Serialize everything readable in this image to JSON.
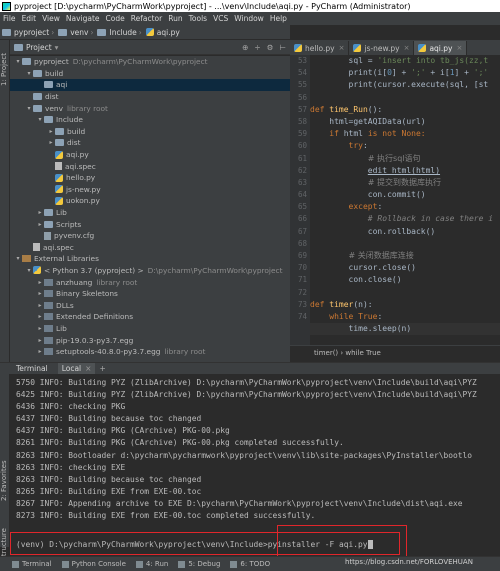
{
  "window": {
    "title": "pyproject [D:\\pycharm\\PyCharmWork\\pyproject] - ...\\venv\\Include\\aqi.py - PyCharm (Administrator)"
  },
  "menu": [
    "File",
    "Edit",
    "View",
    "Navigate",
    "Code",
    "Refactor",
    "Run",
    "Tools",
    "VCS",
    "Window",
    "Help"
  ],
  "breadcrumbs": [
    "pyproject",
    "venv",
    "Include",
    "aqi.py"
  ],
  "project_panel": {
    "label": "Project",
    "tree": [
      {
        "depth": 0,
        "arrow": "▾",
        "icon": "folder",
        "label": "pyproject",
        "note": "D:\\pycharm\\PyCharmWork\\pyproject"
      },
      {
        "depth": 1,
        "arrow": "▾",
        "icon": "folder",
        "label": "build",
        "note": ""
      },
      {
        "depth": 2,
        "arrow": "",
        "icon": "folder",
        "label": "aqi",
        "note": "",
        "selected": true
      },
      {
        "depth": 1,
        "arrow": "",
        "icon": "folder",
        "label": "dist",
        "note": ""
      },
      {
        "depth": 1,
        "arrow": "▾",
        "icon": "folder",
        "label": "venv",
        "note": "library root"
      },
      {
        "depth": 2,
        "arrow": "▾",
        "icon": "folder",
        "label": "Include",
        "note": ""
      },
      {
        "depth": 3,
        "arrow": "▸",
        "icon": "folder",
        "label": "build",
        "note": ""
      },
      {
        "depth": 3,
        "arrow": "▸",
        "icon": "folder",
        "label": "dist",
        "note": ""
      },
      {
        "depth": 3,
        "arrow": "",
        "icon": "py",
        "label": "aqi.py",
        "note": ""
      },
      {
        "depth": 3,
        "arrow": "",
        "icon": "spec",
        "label": "aqi.spec",
        "note": ""
      },
      {
        "depth": 3,
        "arrow": "",
        "icon": "py",
        "label": "hello.py",
        "note": ""
      },
      {
        "depth": 3,
        "arrow": "",
        "icon": "py",
        "label": "js-new.py",
        "note": ""
      },
      {
        "depth": 3,
        "arrow": "",
        "icon": "py",
        "label": "uokon.py",
        "note": ""
      },
      {
        "depth": 2,
        "arrow": "▸",
        "icon": "folder",
        "label": "Lib",
        "note": ""
      },
      {
        "depth": 2,
        "arrow": "▸",
        "icon": "folder",
        "label": "Scripts",
        "note": ""
      },
      {
        "depth": 2,
        "arrow": "",
        "icon": "cfg",
        "label": "pyvenv.cfg",
        "note": ""
      },
      {
        "depth": 1,
        "arrow": "",
        "icon": "spec",
        "label": "aqi.spec",
        "note": ""
      },
      {
        "depth": 0,
        "arrow": "▾",
        "icon": "lib",
        "label": "External Libraries",
        "note": ""
      },
      {
        "depth": 1,
        "arrow": "▾",
        "icon": "py",
        "label": "< Python 3.7 (pyproject) >",
        "note": "D:\\pycharm\\PyCharmWork\\pyproject"
      },
      {
        "depth": 2,
        "arrow": "▸",
        "icon": "pkg",
        "label": "anzhuang",
        "note": "library root"
      },
      {
        "depth": 2,
        "arrow": "▸",
        "icon": "pkg",
        "label": "Binary Skeletons",
        "note": ""
      },
      {
        "depth": 2,
        "arrow": "▸",
        "icon": "pkg",
        "label": "DLLs",
        "note": ""
      },
      {
        "depth": 2,
        "arrow": "▸",
        "icon": "pkg",
        "label": "Extended Definitions",
        "note": ""
      },
      {
        "depth": 2,
        "arrow": "▸",
        "icon": "pkg",
        "label": "Lib",
        "note": ""
      },
      {
        "depth": 2,
        "arrow": "▸",
        "icon": "pkg",
        "label": "pip-19.0.3-py3.7.egg",
        "note": ""
      },
      {
        "depth": 2,
        "arrow": "▸",
        "icon": "pkg",
        "label": "setuptools-40.8.0-py3.7.egg",
        "note": "library root"
      }
    ]
  },
  "editor": {
    "tabs": [
      {
        "label": "hello.py",
        "active": false
      },
      {
        "label": "js-new.py",
        "active": false
      },
      {
        "label": "aqi.py",
        "active": true
      }
    ],
    "line_numbers": [
      "53",
      "54",
      "55",
      "56",
      "57",
      "58",
      "59",
      "60",
      "61",
      "62",
      "63",
      "64",
      "65",
      "66",
      "67",
      "68",
      "69",
      "70",
      "71",
      "72",
      "73",
      "74"
    ],
    "lines": [
      [
        {
          "t": "        sql = ",
          "c": "plain"
        },
        {
          "t": "'insert into tb_js(zz,t",
          "c": "str"
        }
      ],
      [
        {
          "t": "        print(i[",
          "c": "plain"
        },
        {
          "t": "0",
          "c": "num"
        },
        {
          "t": "] + ",
          "c": "plain"
        },
        {
          "t": "';'",
          "c": "str"
        },
        {
          "t": " + i[",
          "c": "plain"
        },
        {
          "t": "1",
          "c": "num"
        },
        {
          "t": "] + ",
          "c": "plain"
        },
        {
          "t": "';'",
          "c": "str"
        }
      ],
      [
        {
          "t": "        print(cursor.execute(sql, [st",
          "c": "plain"
        }
      ],
      [
        {
          "t": "",
          "c": "plain"
        }
      ],
      [
        {
          "t": "def ",
          "c": "kw"
        },
        {
          "t": "time_Run",
          "c": "fn"
        },
        {
          "t": "():",
          "c": "plain"
        }
      ],
      [
        {
          "t": "    html=getAQIData(url)",
          "c": "plain"
        }
      ],
      [
        {
          "t": "    ",
          "c": "plain"
        },
        {
          "t": "if ",
          "c": "kw"
        },
        {
          "t": "html ",
          "c": "plain"
        },
        {
          "t": "is not ",
          "c": "kw"
        },
        {
          "t": "None:",
          "c": "kw"
        }
      ],
      [
        {
          "t": "        ",
          "c": "plain"
        },
        {
          "t": "try",
          "c": "kw"
        },
        {
          "t": ":",
          "c": "plain"
        }
      ],
      [
        {
          "t": "            ",
          "c": "plain"
        },
        {
          "t": "# 执行sql语句",
          "c": "cm zh"
        }
      ],
      [
        {
          "t": "            ",
          "c": "plain"
        },
        {
          "t": "edit_html(html)",
          "c": "plain us"
        }
      ],
      [
        {
          "t": "            ",
          "c": "plain"
        },
        {
          "t": "# 提交到数据库执行",
          "c": "cm zh"
        }
      ],
      [
        {
          "t": "            con.commit()",
          "c": "plain"
        }
      ],
      [
        {
          "t": "        ",
          "c": "plain"
        },
        {
          "t": "except",
          "c": "kw"
        },
        {
          "t": ":",
          "c": "plain"
        }
      ],
      [
        {
          "t": "            ",
          "c": "plain"
        },
        {
          "t": "# Rollback in case there i",
          "c": "cm"
        }
      ],
      [
        {
          "t": "            con.rollback()",
          "c": "plain"
        }
      ],
      [
        {
          "t": "",
          "c": "plain"
        }
      ],
      [
        {
          "t": "        ",
          "c": "plain"
        },
        {
          "t": "# 关闭数据库连接",
          "c": "cm zh"
        }
      ],
      [
        {
          "t": "        cursor.close()",
          "c": "plain"
        }
      ],
      [
        {
          "t": "        con.close()",
          "c": "plain"
        }
      ],
      [
        {
          "t": "",
          "c": "plain"
        }
      ],
      [
        {
          "t": "def ",
          "c": "kw"
        },
        {
          "t": "timer",
          "c": "fn"
        },
        {
          "t": "(n):",
          "c": "plain"
        }
      ],
      [
        {
          "t": "    ",
          "c": "plain"
        },
        {
          "t": "while ",
          "c": "kw"
        },
        {
          "t": "True",
          "c": "kw"
        },
        {
          "t": ":",
          "c": "plain"
        }
      ],
      [
        {
          "t": "        time.sleep(n)",
          "c": "plain"
        }
      ]
    ],
    "breadcrumb": "timer()   ›   while True"
  },
  "terminal": {
    "label": "Terminal",
    "tab": "Local",
    "lines": [
      "5750 INFO: Building PYZ (ZlibArchive) D:\\pycharm\\PyCharmWork\\pyproject\\venv\\Include\\build\\aqi\\PYZ",
      "6425 INFO: Building PYZ (ZlibArchive) D:\\pycharm\\PyCharmWork\\pyproject\\venv\\Include\\build\\aqi\\PYZ",
      "6436 INFO: checking PKG",
      "6437 INFO: Building because toc changed",
      "6437 INFO: Building PKG (CArchive) PKG-00.pkg",
      "8261 INFO: Building PKG (CArchive) PKG-00.pkg completed successfully.",
      "8263 INFO: Bootloader d:\\pycharm\\pycharmwork\\pyproject\\venv\\lib\\site-packages\\PyInstaller\\bootlo",
      "8263 INFO: checking EXE",
      "8263 INFO: Building because toc changed",
      "8265 INFO: Building EXE from EXE-00.toc",
      "8267 INFO: Appending archive to EXE D:\\pycharm\\PyCharmWork\\pyproject\\venv\\Include\\dist\\aqi.exe",
      "8273 INFO: Building EXE from EXE-00.toc completed successfully."
    ],
    "prompt": "(venv) D:\\pycharm\\PyCharmWork\\pyproject\\venv\\Include>",
    "command": "pyinstaller -F aqi.py"
  },
  "sidebar_tabs": [
    "1: Project",
    "2: Favorites",
    "Z: Structure"
  ],
  "status_tabs": [
    "Terminal",
    "Python Console",
    "4: Run",
    "5: Debug",
    "6: TODO"
  ],
  "watermark": "https://blog.csdn.net/FORLOVEHUAN",
  "colors": {
    "accent_red": "#e0262b",
    "selection": "#0d293e",
    "keyword": "#cc7832",
    "function": "#ffc66d",
    "string": "#6a8759",
    "comment": "#808080"
  }
}
